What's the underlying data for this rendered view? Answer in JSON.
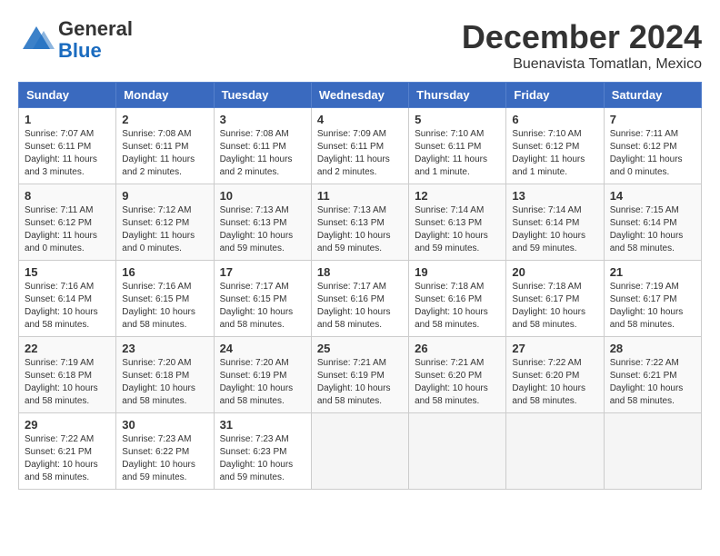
{
  "header": {
    "logo_line1": "General",
    "logo_line2": "Blue",
    "month_title": "December 2024",
    "location": "Buenavista Tomatlan, Mexico"
  },
  "days_of_week": [
    "Sunday",
    "Monday",
    "Tuesday",
    "Wednesday",
    "Thursday",
    "Friday",
    "Saturday"
  ],
  "weeks": [
    [
      {
        "day": "1",
        "sunrise": "7:07 AM",
        "sunset": "6:11 PM",
        "daylight": "11 hours and 3 minutes."
      },
      {
        "day": "2",
        "sunrise": "7:08 AM",
        "sunset": "6:11 PM",
        "daylight": "11 hours and 2 minutes."
      },
      {
        "day": "3",
        "sunrise": "7:08 AM",
        "sunset": "6:11 PM",
        "daylight": "11 hours and 2 minutes."
      },
      {
        "day": "4",
        "sunrise": "7:09 AM",
        "sunset": "6:11 PM",
        "daylight": "11 hours and 2 minutes."
      },
      {
        "day": "5",
        "sunrise": "7:10 AM",
        "sunset": "6:11 PM",
        "daylight": "11 hours and 1 minute."
      },
      {
        "day": "6",
        "sunrise": "7:10 AM",
        "sunset": "6:12 PM",
        "daylight": "11 hours and 1 minute."
      },
      {
        "day": "7",
        "sunrise": "7:11 AM",
        "sunset": "6:12 PM",
        "daylight": "11 hours and 0 minutes."
      }
    ],
    [
      {
        "day": "8",
        "sunrise": "7:11 AM",
        "sunset": "6:12 PM",
        "daylight": "11 hours and 0 minutes."
      },
      {
        "day": "9",
        "sunrise": "7:12 AM",
        "sunset": "6:12 PM",
        "daylight": "11 hours and 0 minutes."
      },
      {
        "day": "10",
        "sunrise": "7:13 AM",
        "sunset": "6:13 PM",
        "daylight": "10 hours and 59 minutes."
      },
      {
        "day": "11",
        "sunrise": "7:13 AM",
        "sunset": "6:13 PM",
        "daylight": "10 hours and 59 minutes."
      },
      {
        "day": "12",
        "sunrise": "7:14 AM",
        "sunset": "6:13 PM",
        "daylight": "10 hours and 59 minutes."
      },
      {
        "day": "13",
        "sunrise": "7:14 AM",
        "sunset": "6:14 PM",
        "daylight": "10 hours and 59 minutes."
      },
      {
        "day": "14",
        "sunrise": "7:15 AM",
        "sunset": "6:14 PM",
        "daylight": "10 hours and 58 minutes."
      }
    ],
    [
      {
        "day": "15",
        "sunrise": "7:16 AM",
        "sunset": "6:14 PM",
        "daylight": "10 hours and 58 minutes."
      },
      {
        "day": "16",
        "sunrise": "7:16 AM",
        "sunset": "6:15 PM",
        "daylight": "10 hours and 58 minutes."
      },
      {
        "day": "17",
        "sunrise": "7:17 AM",
        "sunset": "6:15 PM",
        "daylight": "10 hours and 58 minutes."
      },
      {
        "day": "18",
        "sunrise": "7:17 AM",
        "sunset": "6:16 PM",
        "daylight": "10 hours and 58 minutes."
      },
      {
        "day": "19",
        "sunrise": "7:18 AM",
        "sunset": "6:16 PM",
        "daylight": "10 hours and 58 minutes."
      },
      {
        "day": "20",
        "sunrise": "7:18 AM",
        "sunset": "6:17 PM",
        "daylight": "10 hours and 58 minutes."
      },
      {
        "day": "21",
        "sunrise": "7:19 AM",
        "sunset": "6:17 PM",
        "daylight": "10 hours and 58 minutes."
      }
    ],
    [
      {
        "day": "22",
        "sunrise": "7:19 AM",
        "sunset": "6:18 PM",
        "daylight": "10 hours and 58 minutes."
      },
      {
        "day": "23",
        "sunrise": "7:20 AM",
        "sunset": "6:18 PM",
        "daylight": "10 hours and 58 minutes."
      },
      {
        "day": "24",
        "sunrise": "7:20 AM",
        "sunset": "6:19 PM",
        "daylight": "10 hours and 58 minutes."
      },
      {
        "day": "25",
        "sunrise": "7:21 AM",
        "sunset": "6:19 PM",
        "daylight": "10 hours and 58 minutes."
      },
      {
        "day": "26",
        "sunrise": "7:21 AM",
        "sunset": "6:20 PM",
        "daylight": "10 hours and 58 minutes."
      },
      {
        "day": "27",
        "sunrise": "7:22 AM",
        "sunset": "6:20 PM",
        "daylight": "10 hours and 58 minutes."
      },
      {
        "day": "28",
        "sunrise": "7:22 AM",
        "sunset": "6:21 PM",
        "daylight": "10 hours and 58 minutes."
      }
    ],
    [
      {
        "day": "29",
        "sunrise": "7:22 AM",
        "sunset": "6:21 PM",
        "daylight": "10 hours and 58 minutes."
      },
      {
        "day": "30",
        "sunrise": "7:23 AM",
        "sunset": "6:22 PM",
        "daylight": "10 hours and 59 minutes."
      },
      {
        "day": "31",
        "sunrise": "7:23 AM",
        "sunset": "6:23 PM",
        "daylight": "10 hours and 59 minutes."
      },
      null,
      null,
      null,
      null
    ]
  ],
  "labels": {
    "sunrise": "Sunrise:",
    "sunset": "Sunset:",
    "daylight": "Daylight:"
  }
}
